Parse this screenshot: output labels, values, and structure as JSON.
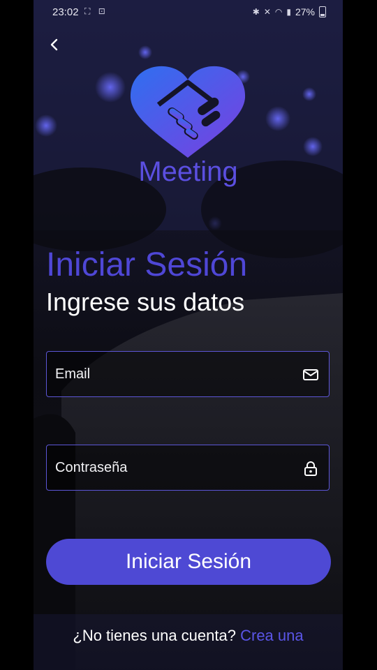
{
  "status_bar": {
    "time": "23:02",
    "battery": "27%",
    "icons": [
      "screenshot-icon",
      "bluetooth-icon",
      "mute-icon",
      "wifi-icon",
      "signal-icon",
      "battery-icon"
    ]
  },
  "header": {
    "back_icon": "chevron-left-icon"
  },
  "brand": {
    "name": "Meeting",
    "logo": "handshake-heart-icon",
    "colors": {
      "gradient_start": "#2f6ff0",
      "gradient_end": "#7a3fe0"
    }
  },
  "login": {
    "title": "Iniciar Sesión",
    "subtitle": "Ingrese sus datos",
    "email": {
      "placeholder": "Email",
      "value": "",
      "icon": "mail-icon"
    },
    "password": {
      "placeholder": "Contraseña",
      "value": "",
      "icon": "lock-icon"
    },
    "submit_label": "Iniciar Sesión",
    "signup_prompt": "¿No tienes una cuenta?",
    "signup_link": "Crea una"
  },
  "theme": {
    "accent": "#4e49d4",
    "text": "#ffffff",
    "link": "#5a55e6"
  }
}
